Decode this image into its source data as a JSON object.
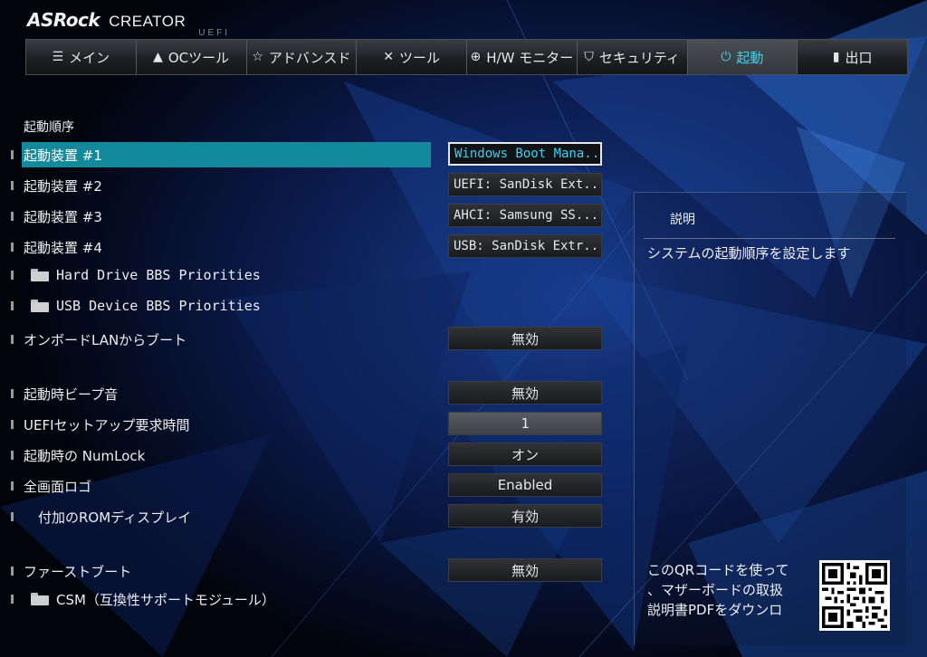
{
  "header": {
    "brand": "ASRock",
    "product": "CREATOR",
    "uefi": "UEFI"
  },
  "nav": {
    "tabs": [
      {
        "label": "メイン",
        "icon": "list-icon"
      },
      {
        "label": "OCツール",
        "icon": "rocket-icon"
      },
      {
        "label": "アドバンスド",
        "icon": "star-icon"
      },
      {
        "label": "ツール",
        "icon": "tools-icon"
      },
      {
        "label": "H/W モニター",
        "icon": "crosshair-icon"
      },
      {
        "label": "セキュリティ",
        "icon": "shield-icon"
      },
      {
        "label": "起動",
        "icon": "power-icon",
        "active": true
      },
      {
        "label": "出口",
        "icon": "exit-door-icon"
      }
    ]
  },
  "main": {
    "section_title": "起動順序",
    "boot_devices": [
      {
        "label": "起動装置 #1",
        "value": "Windows Boot Mana..."
      },
      {
        "label": "起動装置 #2",
        "value": "UEFI: SanDisk Ext..."
      },
      {
        "label": "起動装置 #3",
        "value": "AHCI:  Samsung SS..."
      },
      {
        "label": "起動装置 #4",
        "value": "USB: SanDisk Extr..."
      }
    ],
    "submenus": {
      "hdd_bbs": "Hard Drive BBS Priorities",
      "usb_bbs": "USB Device BBS Priorities",
      "csm": "CSM（互換性サポートモジュール）"
    },
    "settings": {
      "onboard_lan_boot": {
        "label": "オンボードLANからブート",
        "value": "無効"
      },
      "boot_beep": {
        "label": "起動時ビープ音",
        "value": "無効"
      },
      "setup_prompt_timeout": {
        "label": "UEFIセットアップ要求時間",
        "value": "1"
      },
      "boot_numlock": {
        "label": "起動時の NumLock",
        "value": "オン"
      },
      "full_screen_logo": {
        "label": "全画面ロゴ",
        "value": "Enabled"
      },
      "addon_rom_display": {
        "label": "付加のROMディスプレイ",
        "value": "有効"
      },
      "fast_boot": {
        "label": "ファーストブート",
        "value": "無効"
      }
    }
  },
  "help": {
    "title": "説明",
    "text": "システムの起動順序を設定します",
    "qr_text": "このQRコードを使って\n、マザーボードの取扱\n説明書PDFをダウンロ"
  },
  "colors": {
    "accent": "#3fd1ee",
    "selection": "#138a9c"
  }
}
